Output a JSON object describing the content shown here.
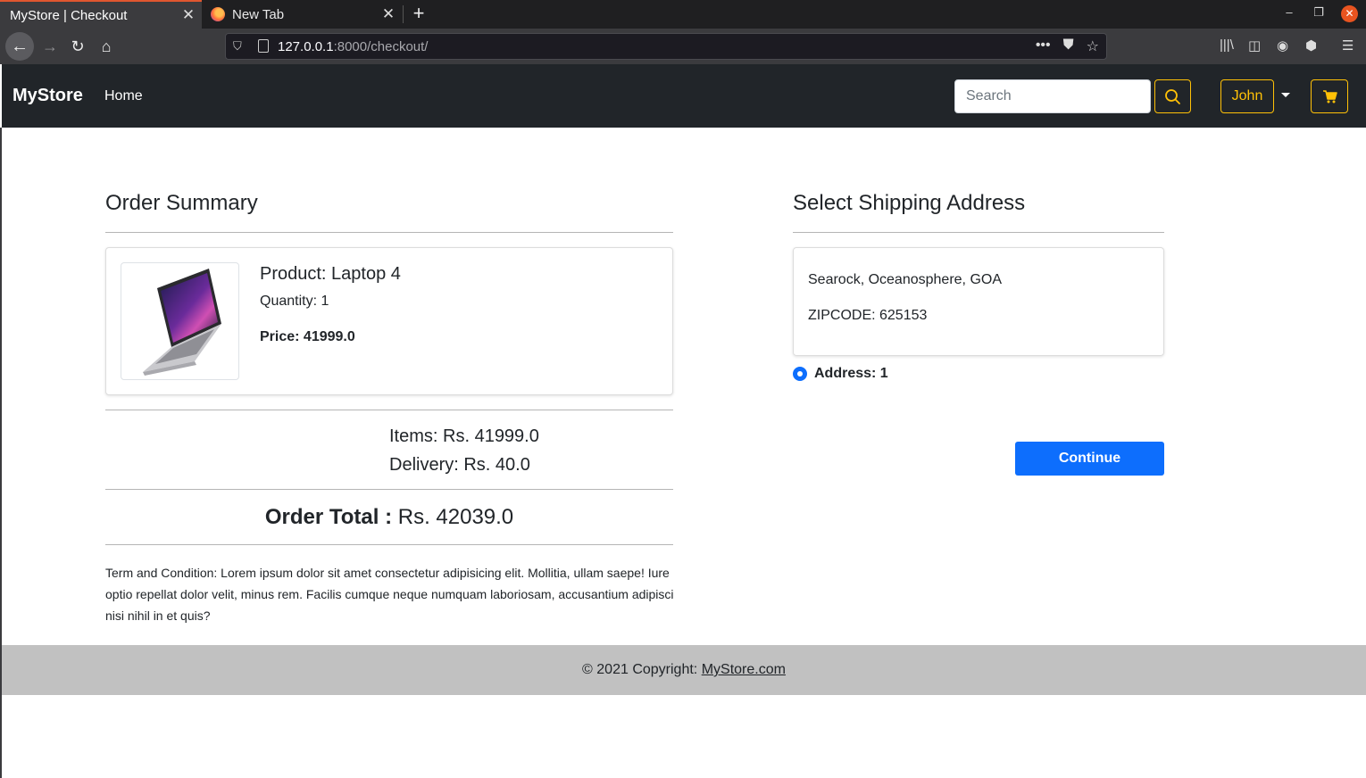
{
  "browser": {
    "tabs": [
      {
        "title": "MyStore | Checkout",
        "active": true
      },
      {
        "title": "New Tab",
        "active": false
      }
    ],
    "url_host": "127.0.0.1",
    "url_rest": ":8000/checkout/"
  },
  "nav": {
    "brand": "MyStore",
    "home": "Home",
    "search_placeholder": "Search",
    "user": "John",
    "accent_color": "#ffc107"
  },
  "order": {
    "title": "Order Summary",
    "product_name": "Product: Laptop 4",
    "quantity": "Quantity: 1",
    "price": "Price: 41999.0",
    "items": "Items: Rs. 41999.0",
    "delivery": "Delivery: Rs. 40.0",
    "total_label": "Order Total :",
    "total_value": "Rs. 42039.0",
    "terms": "Term and Condition: Lorem ipsum dolor sit amet consectetur adipisicing elit. Mollitia, ullam saepe! Iure optio repellat dolor velit, minus rem. Facilis cumque neque numquam laboriosam, accusantium adipisci nisi nihil in et quis?"
  },
  "shipping": {
    "title": "Select Shipping Address",
    "address_line": "Searock, Oceanosphere, GOA",
    "zipcode": "ZIPCODE: 625153",
    "radio_label": "Address: 1",
    "continue": "Continue",
    "primary_color": "#0d6efd"
  },
  "footer": {
    "copyright": "© 2021 Copyright: ",
    "link": "MyStore.com"
  }
}
